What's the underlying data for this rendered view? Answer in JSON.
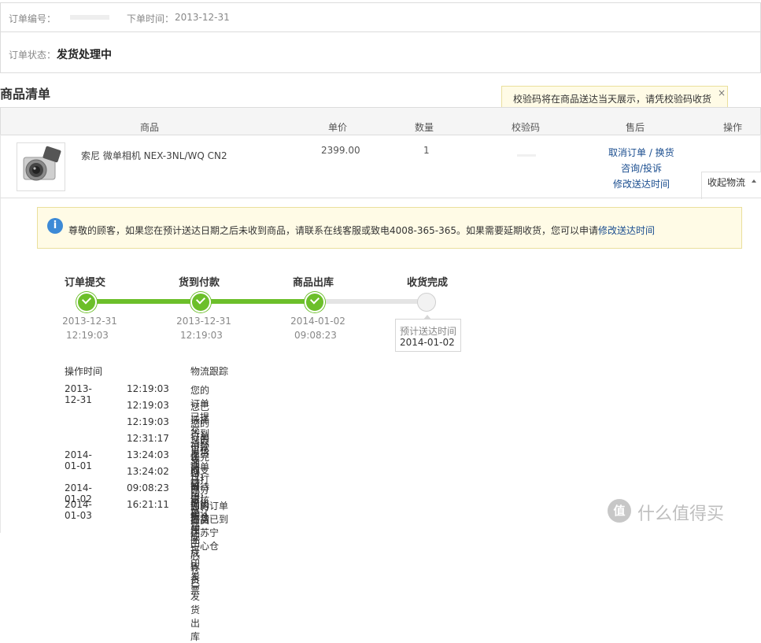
{
  "order_header": {
    "order_no_label": "订单编号：",
    "order_time_label": "下单时间：",
    "order_time": "2013-12-31"
  },
  "status_row": {
    "label": "订单状态：",
    "value": "发货处理中"
  },
  "section_title": "商品清单",
  "tooltip": {
    "text": "校验码将在商品送达当天展示，请凭校验码收货",
    "close": "×"
  },
  "table_headers": {
    "product": "商品",
    "price": "单价",
    "qty": "数量",
    "code": "校验码",
    "after_sale": "售后",
    "action": "操作"
  },
  "product": {
    "name": "索尼 微单相机 NEX-3NL/WQ CN2",
    "price": "2399.00",
    "qty": "1",
    "links": {
      "cancel": "取消订单 / 换货",
      "consult": "咨询/投诉",
      "modify": "修改送达时间"
    },
    "collapse": "收起物流"
  },
  "notice": {
    "text": "尊敬的顾客，如果您在预计送达日期之后未收到商品，请联系在线客服或致电4008-365-365。如果需要延期收货，您可以申请",
    "link": "修改送达时间"
  },
  "progress": {
    "filled_fraction": 0.67,
    "steps": [
      {
        "title": "订单提交",
        "date": "2013-12-31",
        "time": "12:19:03",
        "done": true
      },
      {
        "title": "货到付款",
        "date": "2013-12-31",
        "time": "12:19:03",
        "done": true
      },
      {
        "title": "商品出库",
        "date": "2014-01-02",
        "time": "09:08:23",
        "done": true
      },
      {
        "title": "收货完成",
        "done": false
      }
    ],
    "estimate_label": "预计送达时间",
    "estimate_date": "2014-01-02"
  },
  "logistics": {
    "col_time": "操作时间",
    "col_track": "物流跟踪",
    "rows": [
      {
        "date": "2013-12-31",
        "time": "12:19:03",
        "text": "您的订单已提交，请尽快完成支付"
      },
      {
        "date": "",
        "time": "12:19:03",
        "text": "您已选择货到付款支付，等待审核确认"
      },
      {
        "date": "",
        "time": "12:19:03",
        "text": "您的订单审核通过，已分给出货仓库"
      },
      {
        "date": "",
        "time": "12:31:17",
        "text": "您的发货清单已打印，即将拣货"
      },
      {
        "date": "2014-01-01",
        "time": "13:24:03",
        "text": "您的订单已完成打印发票"
      },
      {
        "date": "",
        "time": "13:24:02",
        "text": "您的订单已完成拣货"
      },
      {
        "date": "2014-01-02",
        "time": "09:08:23",
        "text": "苏宁杭州中心仓已发货出库"
      },
      {
        "date": "2014-01-03",
        "time": "16:21:11",
        "text": "您的订单商品已到达苏宁　　　中心仓"
      }
    ]
  },
  "watermark": {
    "text": "什么值得买",
    "logo_char": "值"
  },
  "colors": {
    "accent_green": "#6cbf2a",
    "link_blue": "#1a4d8f",
    "notice_bg": "#fffbe6",
    "notice_border": "#eadf9c"
  }
}
